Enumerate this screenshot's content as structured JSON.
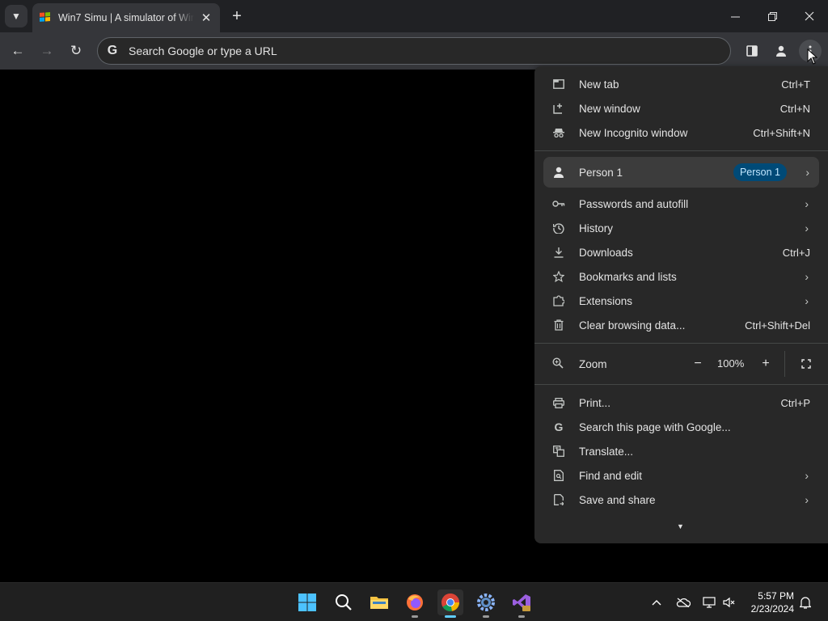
{
  "window": {
    "tab_title": "Win7 Simu | A simulator of Windows 7"
  },
  "toolbar": {
    "omnibox_placeholder": "Search Google or type a URL"
  },
  "menu": {
    "group1": [
      {
        "label": "New tab",
        "shortcut": "Ctrl+T",
        "icon": "new-tab-icon"
      },
      {
        "label": "New window",
        "shortcut": "Ctrl+N",
        "icon": "new-window-icon"
      },
      {
        "label": "New Incognito window",
        "shortcut": "Ctrl+Shift+N",
        "icon": "incognito-icon"
      }
    ],
    "profile": {
      "label": "Person 1",
      "badge": "Person 1"
    },
    "group2": [
      {
        "label": "Passwords and autofill",
        "icon": "key-icon"
      },
      {
        "label": "History",
        "icon": "history-icon"
      },
      {
        "label": "Downloads",
        "shortcut": "Ctrl+J",
        "icon": "download-icon"
      },
      {
        "label": "Bookmarks and lists",
        "icon": "star-icon"
      },
      {
        "label": "Extensions",
        "icon": "puzzle-icon"
      },
      {
        "label": "Clear browsing data...",
        "shortcut": "Ctrl+Shift+Del",
        "icon": "trash-icon"
      }
    ],
    "zoom": {
      "label": "Zoom",
      "value": "100%"
    },
    "group3": [
      {
        "label": "Print...",
        "shortcut": "Ctrl+P",
        "icon": "print-icon"
      },
      {
        "label": "Search this page with Google...",
        "icon": "google-icon"
      },
      {
        "label": "Translate...",
        "icon": "translate-icon"
      },
      {
        "label": "Find and edit",
        "icon": "find-icon"
      },
      {
        "label": "Save and share",
        "icon": "share-icon"
      }
    ]
  },
  "taskbar": {
    "time": "5:57 PM",
    "date": "2/23/2024"
  },
  "colors": {
    "accent": "#60cdff",
    "badge_bg": "#004a77",
    "menu_bg": "#282828"
  }
}
